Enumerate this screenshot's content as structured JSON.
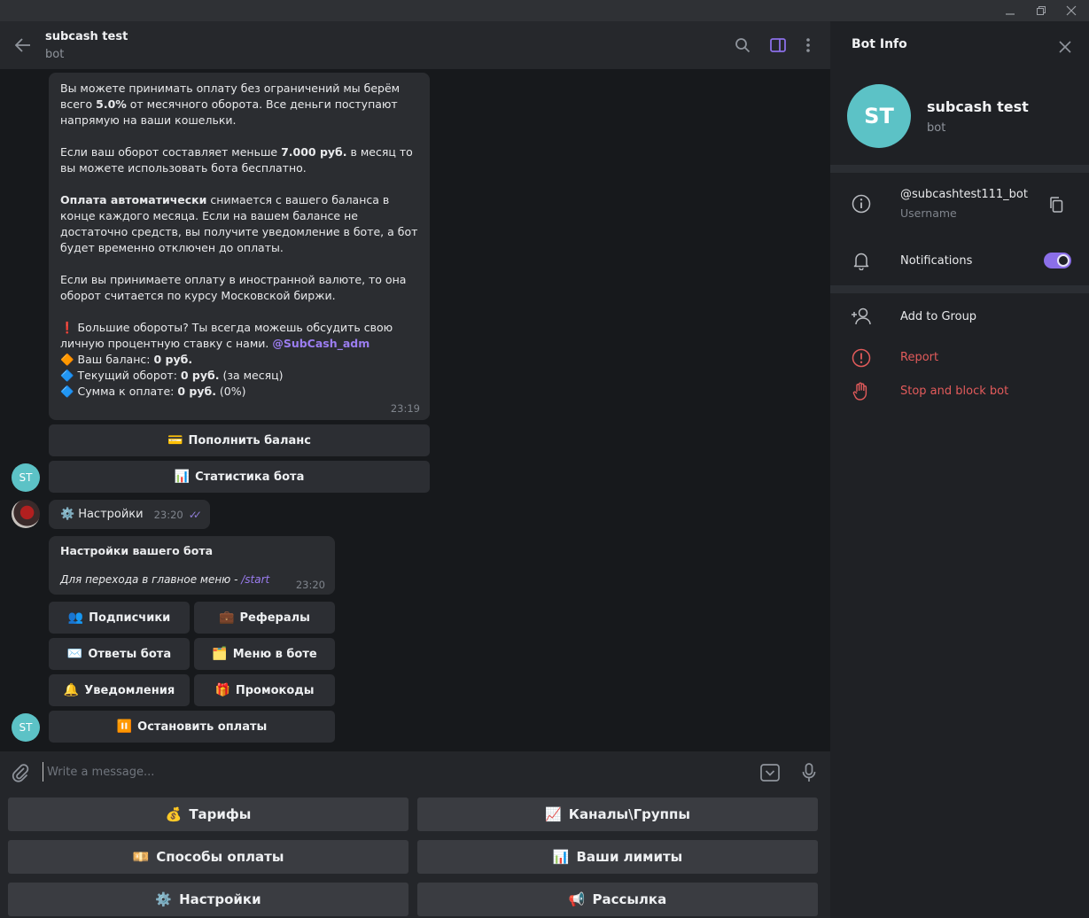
{
  "window": {
    "minimize_glyph": "—",
    "restore_glyph": "❐",
    "close_glyph": "✕"
  },
  "header": {
    "title": "subcash test",
    "status": "bot"
  },
  "messages": {
    "long": {
      "p1_a": "Вы можете принимать оплату без ограничений мы берём всего ",
      "p1_b": "5.0%",
      "p1_c": " от месячного оборота. Все деньги поступают напрямую на ваши кошельки.",
      "p2_a": "Если ваш оборот составляет меньше ",
      "p2_b": "7.000 руб.",
      "p2_c": " в месяц то вы можете использовать бота бесплатно.",
      "p3_a": "Оплата автоматически",
      "p3_b": " снимается с вашего баланса в конце каждого месяца. Если на вашем балансе не достаточно средств, вы получите уведомление в боте, а бот будет временно отключен до оплаты.",
      "p4": "Если вы принимаете оплату в иностранной валюте, то она оборот считается по курсу Московской биржи.",
      "p5_icon": "❗",
      "p5_a": " Большие обороты? Ты всегда можешь обсудить свою личную процентную ставку с нами. ",
      "p5_link": "@SubCash_adm",
      "balance_icon": "🔶",
      "balance_label": " Ваш баланс: ",
      "balance_value": "0 руб.",
      "turnover_icon": "🔷",
      "turnover_label": " Текущий оборот: ",
      "turnover_value": "0 руб.",
      "turnover_suffix": " (за месяц)",
      "due_icon": "🔷",
      "due_label": " Сумма к оплате: ",
      "due_value": "0 руб.",
      "due_suffix": " (0%)",
      "time": "23:19"
    },
    "long_buttons": [
      {
        "icon": "💳",
        "label": "Пополнить баланс"
      },
      {
        "icon": "📊",
        "label": "Статистика бота"
      }
    ],
    "bot_avatar": "ST",
    "outgoing": {
      "icon": "⚙️",
      "text": "Настройки",
      "time": "23:20",
      "ticks": "✓✓"
    },
    "settings": {
      "title": "Настройки вашего бота",
      "hint": "Для перехода в главное меню - ",
      "cmd": "/start",
      "time": "23:20"
    },
    "settings_buttons": [
      {
        "icon": "👥",
        "label": "Подписчики"
      },
      {
        "icon": "💼",
        "label": "Рефералы"
      },
      {
        "icon": "✉️",
        "label": "Ответы бота"
      },
      {
        "icon": "🗂️",
        "label": "Меню в боте"
      },
      {
        "icon": "🔔",
        "label": "Уведомления"
      },
      {
        "icon": "🎁",
        "label": "Промокоды"
      },
      {
        "icon": "⏸️",
        "label": "Остановить оплаты"
      }
    ]
  },
  "composer": {
    "placeholder": "Write a message..."
  },
  "keyboard": [
    {
      "icon": "💰",
      "label": "Тарифы"
    },
    {
      "icon": "📈",
      "label": "Каналы\\Группы"
    },
    {
      "icon": "💴",
      "label": "Способы оплаты"
    },
    {
      "icon": "📊",
      "label": "Ваши лимиты"
    },
    {
      "icon": "⚙️",
      "label": "Настройки"
    },
    {
      "icon": "📢",
      "label": "Рассылка"
    }
  ],
  "panel": {
    "title": "Bot Info",
    "avatar": "ST",
    "name": "subcash test",
    "status": "bot",
    "username": "@subcashtest111_bot",
    "username_label": "Username",
    "notifications": "Notifications",
    "notifications_on": true,
    "add_to_group": "Add to Group",
    "report": "Report",
    "stop_block": "Stop and block bot"
  },
  "colors": {
    "accent": "#8b6fe8",
    "avatar": "#5cc2c6",
    "danger": "#e25b5b"
  }
}
